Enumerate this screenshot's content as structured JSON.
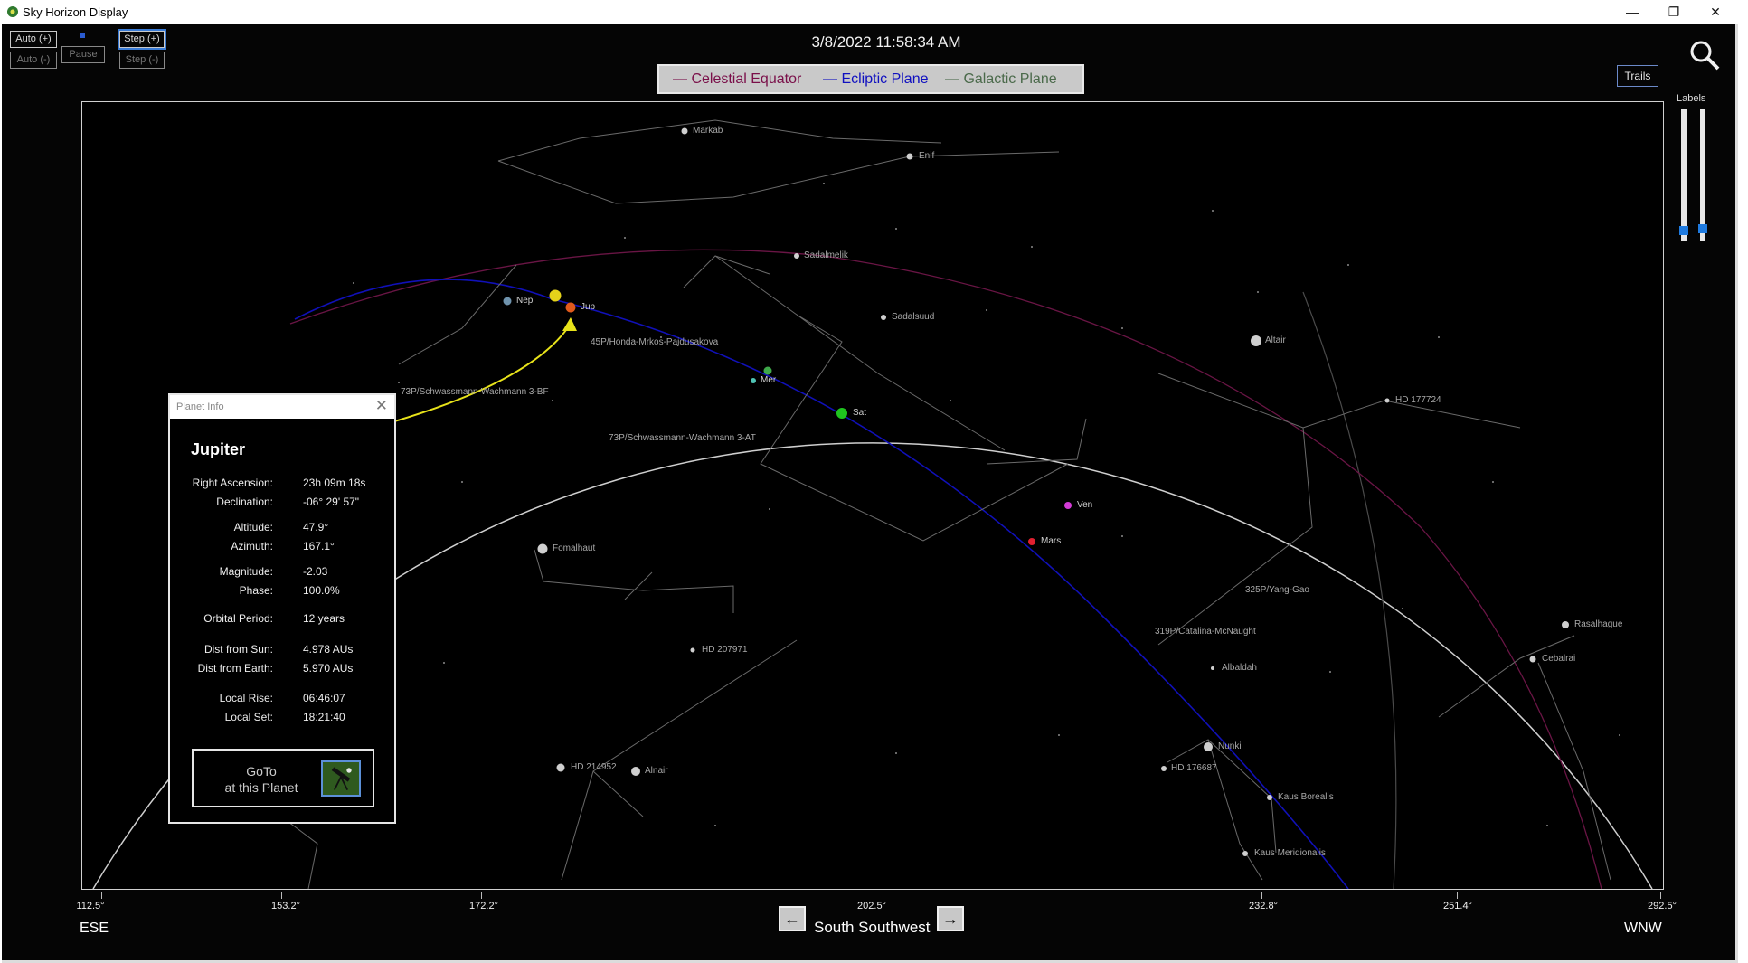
{
  "window": {
    "title": "Sky Horizon Display",
    "buttons": {
      "minimize": "—",
      "restore": "❐",
      "close": "✕"
    }
  },
  "controls": {
    "auto_plus": "Auto (+)",
    "auto_minus": "Auto (-)",
    "pause": "Pause",
    "step_plus": "Step (+)",
    "step_minus": "Step (-)"
  },
  "datetime": "3/8/2022 11:58:34 AM",
  "legend": {
    "celestial": "— Celestial Equator",
    "ecliptic": "— Ecliptic Plane",
    "galactic": "— Galactic Plane",
    "colors": {
      "celestial": "#7a0f49",
      "ecliptic": "#1010c0",
      "galactic": "#4b6a4b"
    }
  },
  "trails_label": "Trails",
  "labels_caption": "Labels",
  "sky_labels": {
    "markab": "Markab",
    "enif": "Enif",
    "sadalmelik": "Sadalmelik",
    "sadalsuud": "Sadalsuud",
    "nep": "Nep",
    "jup": "Jup",
    "comet_45p": "45P/Honda-Mrkos-Pajdusakova",
    "comet_73p_bf": "73P/Schwassmann-Wachmann 3-BF",
    "comet_73p_at": "73P/Schwassmann-Wachmann 3-AT",
    "mer": "Mer",
    "sat": "Sat",
    "ven": "Ven",
    "mars": "Mars",
    "altair": "Altair",
    "hd177724": "HD 177724",
    "fomalhaut": "Fomalhaut",
    "comet_325p": "325P/Yang-Gao",
    "comet_319p": "319P/Catalina-McNaught",
    "albaldah": "Albaldah",
    "hd207971": "HD 207971",
    "rasalhague": "Rasalhague",
    "cebalrai": "Cebalrai",
    "nunki": "Nunki",
    "hd176687": "HD 176687",
    "kaus_borealis": "Kaus Borealis",
    "hd214952": "HD 214952",
    "alnair": "Alnair",
    "kaus_meridionalis": "Kaus Meridionalis"
  },
  "planet_colors": {
    "jup": "#e05a1c",
    "sun": "#e4d21a",
    "nep": "#6f93ad",
    "mer": "#4fc3b4",
    "mer_green": "#3ea84a",
    "sat": "#1fc41f",
    "ven": "#d33bd6",
    "mars": "#e02030",
    "arrow": "#e8e31a"
  },
  "axis": {
    "ticks": [
      "112.5°",
      "153.2°",
      "172.2°",
      "202.5°",
      "232.8°",
      "251.4°",
      "292.5°"
    ],
    "left_dir": "ESE",
    "center_dir": "South Southwest",
    "right_dir": "WNW",
    "prev_icon": "←",
    "next_icon": "→"
  },
  "planet_info": {
    "window_title": "Planet Info",
    "name": "Jupiter",
    "rows": [
      {
        "k": "Right Ascension:",
        "v": "23h 09m 18s"
      },
      {
        "k": "Declination:",
        "v": "-06° 29' 57\""
      },
      {
        "k": "Altitude:",
        "v": "47.9°"
      },
      {
        "k": "Azimuth:",
        "v": "167.1°"
      },
      {
        "k": "Magnitude:",
        "v": "-2.03"
      },
      {
        "k": "Phase:",
        "v": "100.0%"
      },
      {
        "k": "Orbital Period:",
        "v": "12 years"
      },
      {
        "k": "Dist from Sun:",
        "v": "4.978 AUs"
      },
      {
        "k": "Dist from Earth:",
        "v": "5.970 AUs"
      },
      {
        "k": "Local Rise:",
        "v": "06:46:07"
      },
      {
        "k": "Local Set:",
        "v": "18:21:40"
      }
    ],
    "goto_line1": "GoTo",
    "goto_line2": "at this Planet"
  }
}
